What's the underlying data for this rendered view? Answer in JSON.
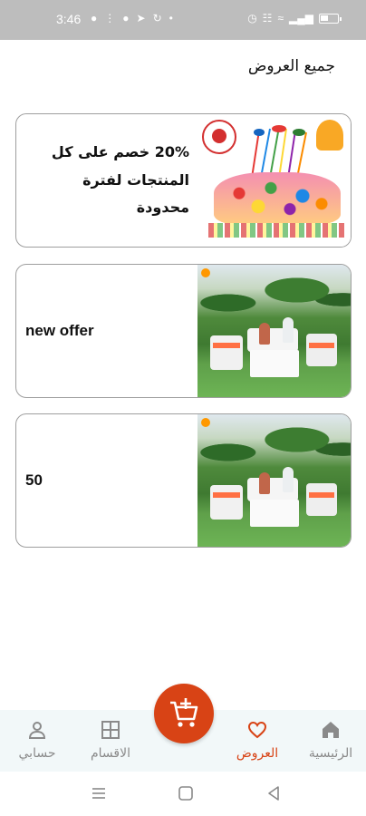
{
  "status_bar": {
    "time": "3:46",
    "left_icons": [
      "whatsapp-icon",
      "network-icon",
      "messenger-icon",
      "telegram-icon",
      "sync-icon",
      "dot-icon"
    ],
    "right_icons": [
      "alarm-icon",
      "vibrate-icon",
      "wifi-icon",
      "signal-icon",
      "battery-icon"
    ]
  },
  "page": {
    "title": "جميع العروض"
  },
  "offers": [
    {
      "text_line1": "20% خصم على كل",
      "text_line2": "المنتجات لفترة محدودة",
      "image": "toys-promo-image"
    },
    {
      "text": "new offer",
      "image": "garden-furniture-image"
    },
    {
      "text": "50",
      "image": "garden-furniture-image"
    }
  ],
  "bottom_nav": {
    "home_label": "الرئيسية",
    "offers_label": "العروض",
    "categories_label": "الاقسام",
    "account_label": "حسابي",
    "active": "offers"
  },
  "fab": {
    "icon": "add-to-cart-icon"
  },
  "colors": {
    "accent": "#d84315",
    "nav_background": "#f2f8f9",
    "status_bar": "#bdbdbd",
    "inactive": "#8a8a8a"
  }
}
